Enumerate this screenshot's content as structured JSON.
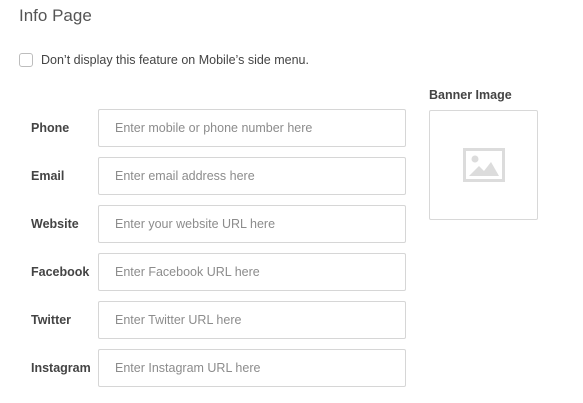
{
  "page": {
    "title": "Info Page"
  },
  "mobile_option": {
    "checked": false,
    "label": "Don’t display this feature on Mobile’s side menu."
  },
  "form": {
    "fields": [
      {
        "label": "Phone",
        "placeholder": "Enter mobile or phone number here",
        "value": ""
      },
      {
        "label": "Email",
        "placeholder": "Enter email address here",
        "value": ""
      },
      {
        "label": "Website",
        "placeholder": "Enter your website URL here",
        "value": ""
      },
      {
        "label": "Facebook",
        "placeholder": "Enter Facebook URL here",
        "value": ""
      },
      {
        "label": "Twitter",
        "placeholder": "Enter Twitter URL here",
        "value": ""
      },
      {
        "label": "Instagram",
        "placeholder": "Enter Instagram URL here",
        "value": ""
      }
    ]
  },
  "banner": {
    "label": "Banner Image",
    "icon": "image-placeholder-icon"
  }
}
